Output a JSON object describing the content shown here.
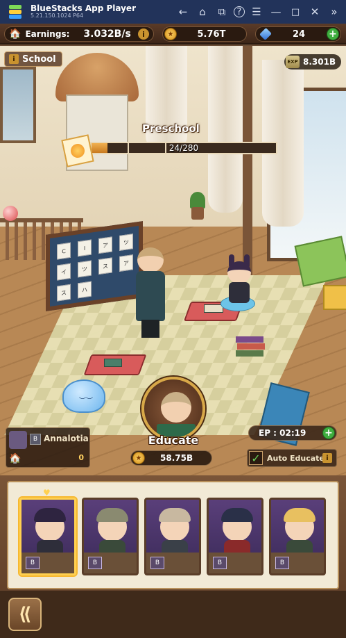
{
  "app": {
    "name": "BlueStacks App Player",
    "version": "5.21.150.1024  P64"
  },
  "titlebar_icons": [
    "back-arrow-icon",
    "home-icon",
    "multi-window-icon",
    "help-icon",
    "menu-icon",
    "minimize-icon",
    "maximize-icon",
    "close-icon",
    "expand-icon"
  ],
  "resources": {
    "earnings_label": "Earnings:",
    "earnings_value": "3.032B/s",
    "coins_value": "5.76T",
    "gems_value": "24"
  },
  "location": {
    "name": "School",
    "exp_badge": "EXP",
    "exp_value": "8.301B"
  },
  "stage": {
    "name": "Preschool",
    "progress_text": "24/280",
    "progress_fraction": 0.086
  },
  "blackboard": {
    "cards": [
      "C",
      "I",
      "ア",
      "ツ",
      "イ",
      "ツ",
      "ス",
      "ア",
      "ス",
      "ハ"
    ]
  },
  "character": {
    "name": "Annalotia",
    "rank_badge": "B",
    "value": "0"
  },
  "educate": {
    "label": "Educate",
    "cost": "58.75B"
  },
  "ep": {
    "label": "EP : 02:19"
  },
  "auto_educate": {
    "label": "Auto Educate",
    "checked": true
  },
  "roster": {
    "cards": [
      {
        "rank": "B",
        "selected": true,
        "hair": "#2e2440",
        "outfit": "#2e2e3a"
      },
      {
        "rank": "B",
        "selected": false,
        "hair": "#8a8a70",
        "outfit": "#3a4a3a"
      },
      {
        "rank": "B",
        "selected": false,
        "hair": "#c8b8a0",
        "outfit": "#3a4048"
      },
      {
        "rank": "B",
        "selected": false,
        "hair": "#2a3048",
        "outfit": "#8a2a2a"
      },
      {
        "rank": "B",
        "selected": false,
        "hair": "#e8c060",
        "outfit": "#3a4a3a"
      }
    ]
  },
  "colors": {
    "titlebar": "#22335a",
    "frame": "#5a3a24",
    "accent_gold": "#d8a848",
    "plus_green": "#3fae3f"
  }
}
